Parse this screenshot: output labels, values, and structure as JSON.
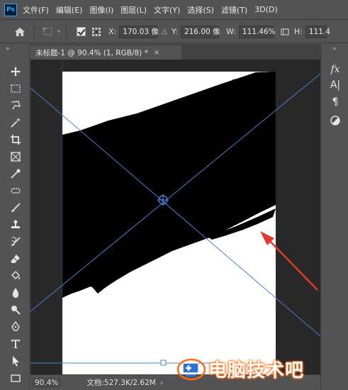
{
  "menubar": {
    "logo": "Ps",
    "items": [
      "文件(F)",
      "编辑(E)",
      "图像(I)",
      "图层(L)",
      "文字(Y)",
      "选择(S)",
      "滤镜(T)",
      "3D(D)"
    ]
  },
  "options": {
    "x_label": "X:",
    "x_value": "170.03 像",
    "y_label": "Y:",
    "y_value": "216.00 像",
    "w_label": "W:",
    "w_value": "111.46%",
    "h_label": "H:",
    "h_value": "111.4"
  },
  "document_tab": {
    "title": "未标题-1 @ 90.4% (1, RGB/8) *",
    "close": "×"
  },
  "status": {
    "zoom": "90.4%",
    "doc_info": "文档:527.3K/2.62M",
    "arrow": "›"
  },
  "right_panel": {
    "icons": [
      "fx-icon",
      "character-icon",
      "paragraph-icon",
      "adjust-icon"
    ],
    "fx": "fx",
    "char": "A|",
    "para": "¶"
  },
  "watermark": {
    "text": "电脑技术吧"
  },
  "colors": {
    "guide": "#4a7fd4",
    "arrow": "#e03a2f",
    "watermark_glow": "#ff6a13"
  }
}
